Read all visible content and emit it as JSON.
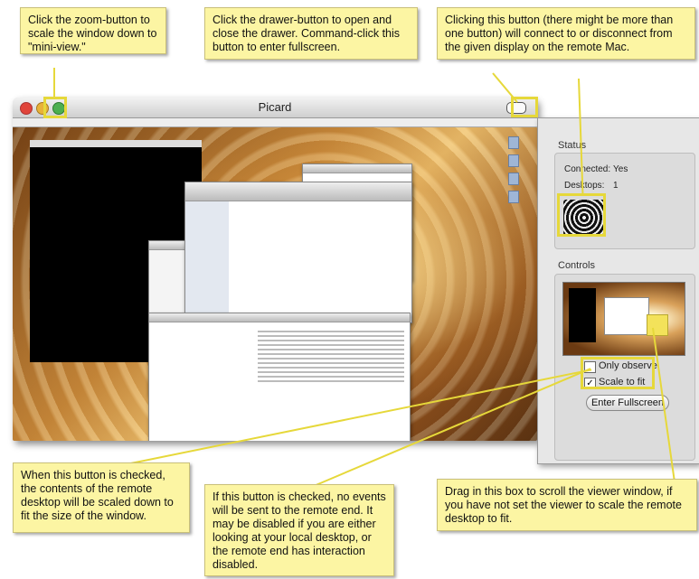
{
  "window": {
    "title": "Picard"
  },
  "drawer": {
    "status_label": "Status",
    "connected_label": "Connected:",
    "connected_value": "Yes",
    "desktops_label": "Desktops:",
    "desktops_value": "1",
    "controls_label": "Controls",
    "only_observe_label": "Only observe",
    "only_observe_checked": false,
    "scale_to_fit_label": "Scale to fit",
    "scale_to_fit_checked": true,
    "fullscreen_button": "Enter Fullscreen"
  },
  "callouts": {
    "zoom": "Click the zoom-button to scale the window down to \"mini-view.\"",
    "drawer": "Click the drawer-button to open and close the drawer. Command-click this button to enter fullscreen.",
    "display": "Clicking this button (there might be more than one button) will connect to or disconnect from the given display on the remote Mac.",
    "scale": "When this button is checked, the contents of the remote desktop will be scaled down to fit the size of the window.",
    "observe": "If this button is checked, no events will be sent to the remote end. It may be disabled if you are either looking at your local desktop, or the remote end has interaction disabled.",
    "scroll": "Drag in this box to scroll the viewer window, if you have not set the viewer to scale the remote desktop to fit."
  },
  "colors": {
    "note_bg": "#fcf5a3",
    "highlight": "#e6d83a",
    "close": "#e0443a",
    "minimize": "#e8b23a",
    "zoom": "#4caf50"
  }
}
